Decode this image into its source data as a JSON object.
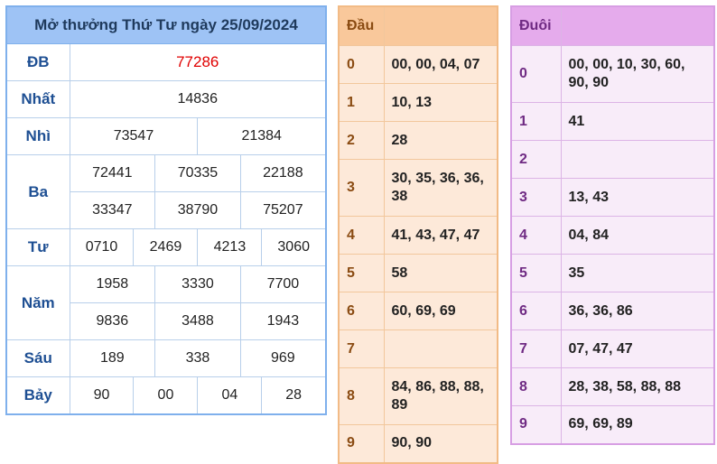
{
  "results": {
    "title": "Mở thưởng Thứ Tư ngày 25/09/2024",
    "db": {
      "label": "ĐB",
      "value": "77286",
      "color": "#e00000"
    },
    "nhat": {
      "label": "Nhất",
      "value": "14836"
    },
    "nhi": {
      "label": "Nhì",
      "values": [
        "73547",
        "21384"
      ]
    },
    "ba": {
      "label": "Ba",
      "values": [
        "72441",
        "70335",
        "22188",
        "33347",
        "38790",
        "75207"
      ]
    },
    "tu": {
      "label": "Tư",
      "values": [
        "0710",
        "2469",
        "4213",
        "3060"
      ]
    },
    "nam": {
      "label": "Năm",
      "values": [
        "1958",
        "3330",
        "7700",
        "9836",
        "3488",
        "1943"
      ]
    },
    "sau": {
      "label": "Sáu",
      "values": [
        "189",
        "338",
        "969"
      ]
    },
    "bay": {
      "label": "Bảy",
      "values": [
        "90",
        "00",
        "04",
        "28"
      ]
    }
  },
  "dau": {
    "header": "Đầu",
    "rows": [
      {
        "digit": "0",
        "values": "00, 00, 04, 07"
      },
      {
        "digit": "1",
        "values": "10, 13"
      },
      {
        "digit": "2",
        "values": "28"
      },
      {
        "digit": "3",
        "values": "30, 35, 36, 36, 38"
      },
      {
        "digit": "4",
        "values": "41, 43, 47, 47"
      },
      {
        "digit": "5",
        "values": "58"
      },
      {
        "digit": "6",
        "values": "60, 69, 69"
      },
      {
        "digit": "7",
        "values": ""
      },
      {
        "digit": "8",
        "values": "84, 86, 88, 88, 89"
      },
      {
        "digit": "9",
        "values": "90, 90"
      }
    ]
  },
  "duoi": {
    "header": "Đuôi",
    "rows": [
      {
        "digit": "0",
        "values": "00, 00, 10, 30, 60, 90, 90"
      },
      {
        "digit": "1",
        "values": "41"
      },
      {
        "digit": "2",
        "values": ""
      },
      {
        "digit": "3",
        "values": "13, 43"
      },
      {
        "digit": "4",
        "values": "04, 84"
      },
      {
        "digit": "5",
        "values": "35"
      },
      {
        "digit": "6",
        "values": "36, 36, 86"
      },
      {
        "digit": "7",
        "values": "07, 47, 47"
      },
      {
        "digit": "8",
        "values": "28, 38, 58, 88, 88"
      },
      {
        "digit": "9",
        "values": "69, 69, 89"
      }
    ]
  },
  "theme": {
    "results_header_bg": "#9ec3f5",
    "dau_header_bg": "#f9c89b",
    "duoi_header_bg": "#e5abec"
  }
}
